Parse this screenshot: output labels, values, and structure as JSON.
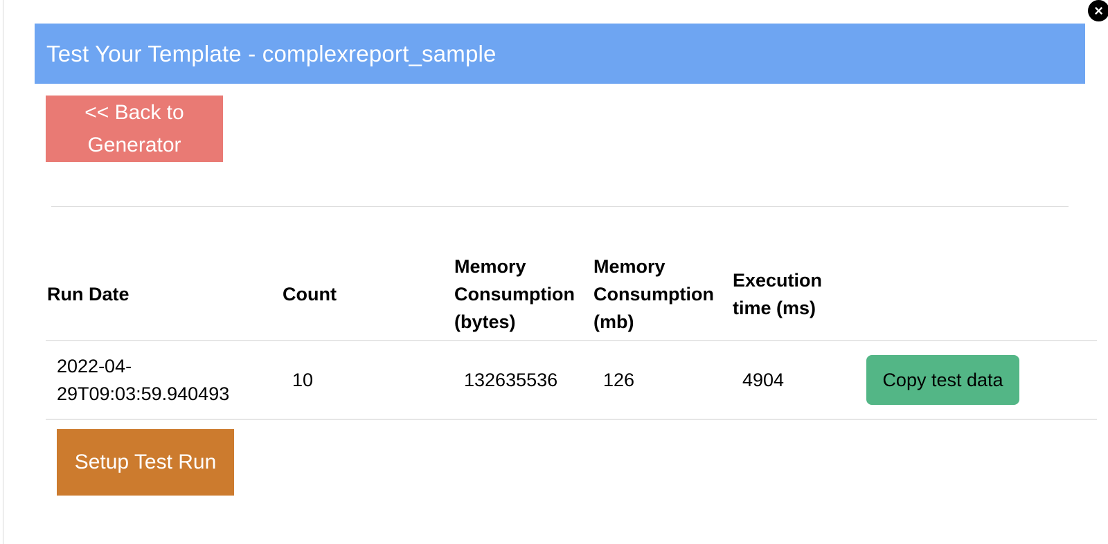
{
  "dialog": {
    "close_symbol": "×",
    "title": "Test Your Template - complexreport_sample"
  },
  "buttons": {
    "back": "<< Back to Generator",
    "copy": "Copy test data",
    "setup": "Setup Test Run"
  },
  "colors": {
    "header": "#6ea5f2",
    "back_button": "#e97a74",
    "copy_button": "#53b686",
    "setup_button": "#cc7b2e"
  },
  "table": {
    "headers": {
      "run_date": "Run Date",
      "count": "Count",
      "mem_bytes": "Memory Consumption (bytes)",
      "mem_mb": "Memory Consumption (mb)",
      "exec_time": "Execution time (ms)"
    },
    "rows": [
      {
        "run_date": "2022-04-29T09:03:59.940493",
        "count": "10",
        "mem_bytes": "132635536",
        "mem_mb": "126",
        "exec_time": "4904"
      }
    ]
  }
}
